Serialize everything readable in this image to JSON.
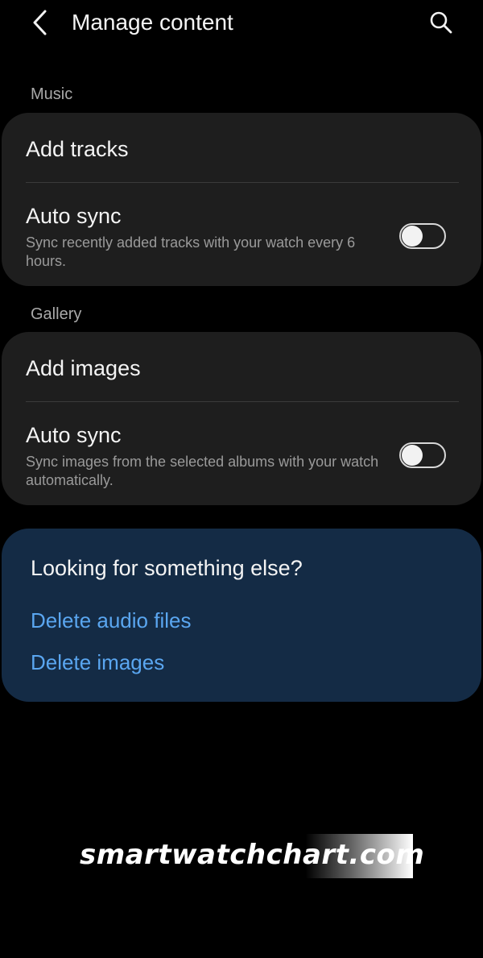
{
  "header": {
    "title": "Manage content",
    "back_icon": "back-arrow-icon",
    "search_icon": "search-icon"
  },
  "music": {
    "section_label": "Music",
    "add_label": "Add tracks",
    "auto_sync": {
      "title": "Auto sync",
      "subtitle": "Sync recently added tracks with your watch every 6 hours.",
      "enabled": false
    }
  },
  "gallery": {
    "section_label": "Gallery",
    "add_label": "Add images",
    "auto_sync": {
      "title": "Auto sync",
      "subtitle": "Sync images from the selected albums with your watch automatically.",
      "enabled": false
    }
  },
  "tip": {
    "title": "Looking for something else?",
    "links": [
      "Delete audio files",
      "Delete images"
    ]
  },
  "watermark": {
    "text": "smartwatchchart.com"
  },
  "colors": {
    "background": "#000000",
    "card": "#1e1e1e",
    "tip_card": "#142b45",
    "link": "#5aa6f0"
  }
}
